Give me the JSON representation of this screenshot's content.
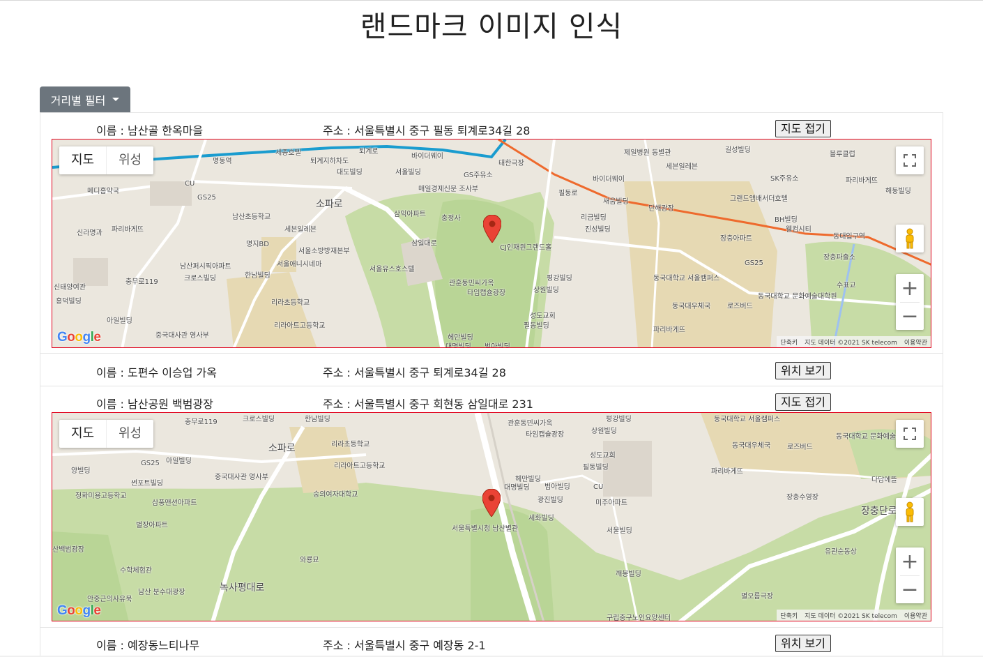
{
  "page": {
    "title": "랜드마크 이미지 인식"
  },
  "filter": {
    "label": "거리별 필터"
  },
  "items": [
    {
      "name": "이름 : 남산골 한옥마을",
      "address": "주소 : 서울특별시 중구 필동 퇴계로34길 28",
      "button": "지도 접기",
      "expanded": true
    },
    {
      "name": "이름 : 도편수 이승업 가옥",
      "address": "주소 : 서울특별시 중구 퇴계로34길 28",
      "button": "위치 보기",
      "expanded": false
    },
    {
      "name": "이름 : 남산공원 백범광장",
      "address": "주소 : 서울특별시 중구 회현동 삼일대로 231",
      "button": "지도 접기",
      "expanded": true
    },
    {
      "name": "이름 : 예장동느티나무",
      "address": "주소 : 서울특별시 중구 예장동 2-1",
      "button": "위치 보기",
      "expanded": false
    }
  ],
  "map_controls": {
    "map_type": "지도",
    "satellite": "위성",
    "shortcut": "단축키",
    "data": "지도 데이터 ©2021 SK telecom",
    "terms": "이용약관",
    "logo": "Google"
  },
  "map1_labels": [
    "명동역",
    "세종호텔",
    "퇴계로",
    "바이더웨이",
    "태한극장",
    "제일병원 동별관",
    "길성빌딩",
    "블루클럽",
    "세븐일레븐",
    "메디홈약국",
    "GS25",
    "CU",
    "퇴계지하차도",
    "대도빌딩",
    "서울빌딩",
    "GS주유소",
    "매일경제신문 조사부",
    "바이더웨이",
    "SK주유소",
    "파리바게뜨",
    "해동빌딩",
    "남산초등학교",
    "삼익아파트",
    "충정사",
    "필동로",
    "새움빌딩",
    "단해광장",
    "그랜드앰배서더호텔",
    "신라명과",
    "파리바게뜨",
    "세븐일레븐",
    "리금빌딩",
    "진성빌딩",
    "BH빌딩",
    "웰컴시티",
    "명지BD",
    "서울소방방재본부",
    "CJ인재원그랜드홀",
    "동대입구역",
    "장충아파트",
    "서울애니시네마",
    "서울유스호스텔",
    "남산퍼시픽아파트",
    "삼일대로",
    "GS25",
    "장충파출소",
    "충무로119",
    "크로스빌딩",
    "한남빌딩",
    "관훈동민씨가옥",
    "평강빌딩",
    "동국대학교 서울캠퍼스",
    "수표교",
    "신태양여관",
    "타임캡슐광장",
    "상원빌딩",
    "리라초등학교",
    "동국대학교 문화예술대학원",
    "홍덕빌딩",
    "동국대우체국",
    "로즈버드",
    "아일빌딩",
    "성도교회",
    "리라아트고등학교",
    "필동빌딩",
    "파리바게뜨",
    "중국대사관 영사부",
    "헤만빌딩",
    "대명빌딩",
    "범아빌딩",
    "소파로"
  ],
  "map2_labels": [
    "충무로119",
    "크로스빌딩",
    "한남빌딩",
    "관훈동민씨가옥",
    "타임캡슐광장",
    "평강빌딩",
    "상원빌딩",
    "동국대학교 서울캠퍼스",
    "동국대우체국",
    "로즈버드",
    "동국대학교 문화예술대학원",
    "리라초등학교",
    "성도교회",
    "GS25",
    "아일빌딩",
    "리라아트고등학교",
    "필동빌딩",
    "파리바게뜨",
    "양빌딩",
    "중국대사관 영사부",
    "헤만빌딩",
    "대명빌딩",
    "범아빌딩",
    "다담에뜰",
    "썬포트빌딩",
    "숭의여자대학교",
    "광진빌딩",
    "CU",
    "미주아파트",
    "정화미용고등학교",
    "삼풍맨션아파트",
    "장충수영장",
    "별장아파트",
    "서울특별시청 남산별관",
    "세화빌딩",
    "서울빌딩",
    "유관순동상",
    "산백범광장",
    "와룡묘",
    "수학체험관",
    "남산 분수대광장",
    "깨봉빌딩",
    "안중근의사유묵",
    "별오름극장",
    "구립중구노인요양센터",
    "소파로",
    "장충단로",
    "녹사평대로"
  ]
}
